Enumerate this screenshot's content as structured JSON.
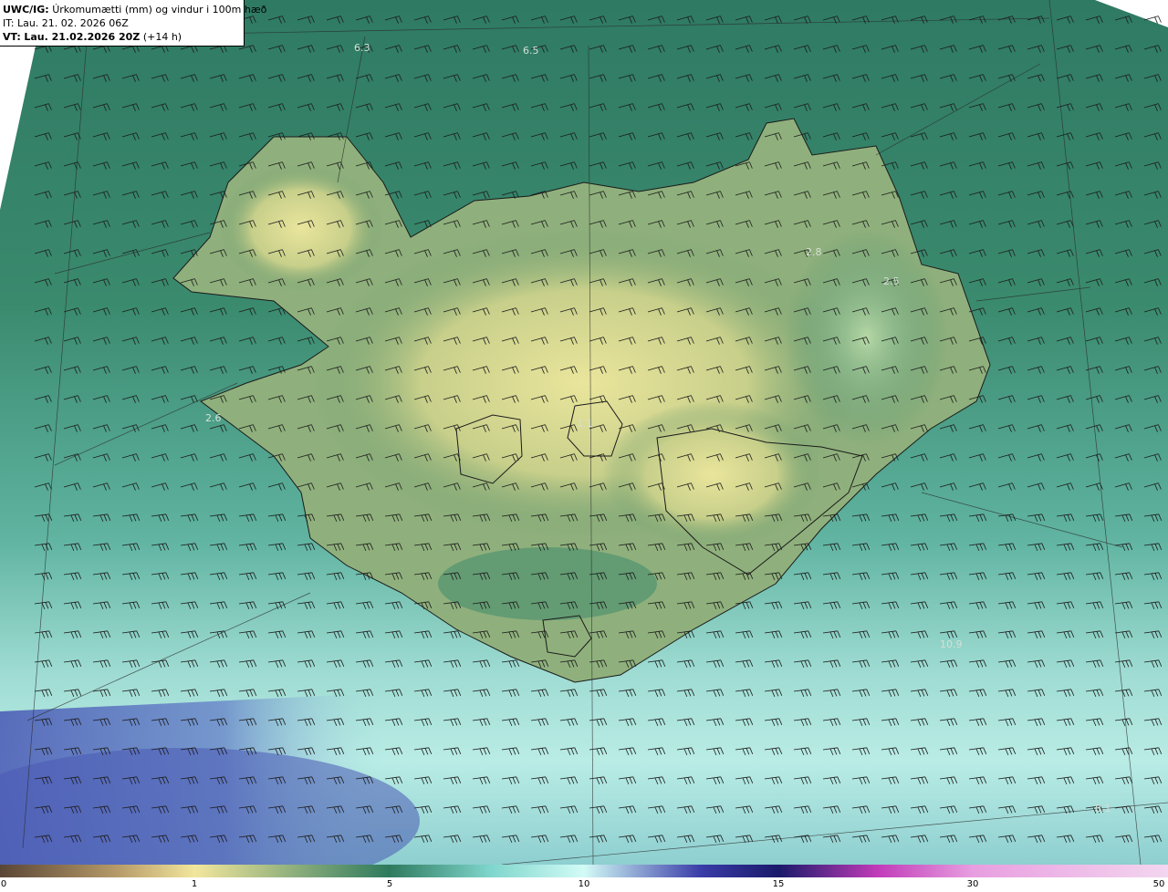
{
  "header": {
    "product": "UWC/IG:",
    "title": "Úrkomumætti (mm) og vindur i 100m hæð",
    "it_line": "IT: Lau. 21. 02. 2026 06Z",
    "vt_label": "VT:",
    "vt_value": "Lau. 21.02.2026 20Z",
    "vt_offset": "(+14 h)"
  },
  "map_labels": [
    "6.3",
    "6.5",
    "2.8",
    "2.5",
    "2.6",
    "1.1",
    "10.9",
    "8.1"
  ],
  "colorbar": {
    "ticks": [
      "0",
      "1",
      "5",
      "10",
      "15",
      "30",
      "50"
    ],
    "colors": [
      "#5a4636",
      "#b69a68",
      "#f2e69c",
      "#2e7a5e",
      "#7fd6cc",
      "#d2fbf6",
      "#3a3ca8",
      "#1a1a6a",
      "#c03ab8",
      "#e89ee0",
      "#f3d6ef"
    ]
  },
  "field_colors": {
    "sea_north": "#2c7a64",
    "sea_south": "#8fd8d0",
    "land_high": "#e6e09a",
    "land_low": "#4c8c6a",
    "sea_far_south": "#4f63b8",
    "coastline": "#1a1a1a"
  }
}
